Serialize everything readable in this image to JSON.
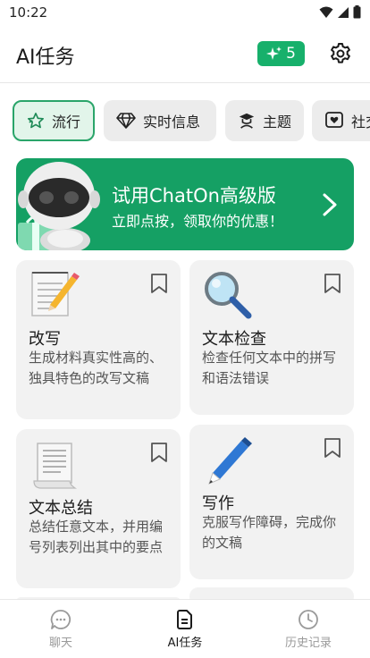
{
  "status_bar": {
    "time": "10:22"
  },
  "header": {
    "title": "AI任务",
    "credits": "5"
  },
  "chips": [
    {
      "label": "流行",
      "icon": "star-icon"
    },
    {
      "label": "实时信息",
      "icon": "diamond-icon"
    },
    {
      "label": "主题",
      "icon": "graduate-icon"
    },
    {
      "label": "社交",
      "icon": "heart-chat-icon"
    }
  ],
  "promo": {
    "title": "试用ChatOn高级版",
    "subtitle": "立即点按，领取你的优惠！"
  },
  "cards": [
    {
      "title": "改写",
      "desc": "生成材料真实性高的、独具特色的改写文稿",
      "icon": "notepad-pencil-icon"
    },
    {
      "title": "文本检查",
      "desc": "检查任何文本中的拼写和语法错误",
      "icon": "magnifier-icon"
    },
    {
      "title": "文本总结",
      "desc": "总结任意文本，并用编号列表列出其中的要点",
      "icon": "document-scroll-icon"
    },
    {
      "title": "写作",
      "desc": "克服写作障碍，完成你的文稿",
      "icon": "pen-icon"
    }
  ],
  "nav": [
    {
      "label": "聊天",
      "icon": "chat-icon"
    },
    {
      "label": "AI任务",
      "icon": "document-icon"
    },
    {
      "label": "历史记录",
      "icon": "clock-icon"
    }
  ],
  "colors": {
    "accent": "#15a064",
    "badge": "#17b06b",
    "card_bg": "#f2f2f2"
  }
}
